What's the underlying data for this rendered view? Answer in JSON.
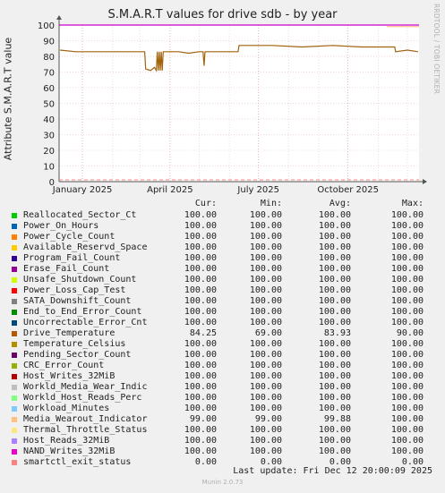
{
  "chart_data": {
    "type": "line",
    "title": "S.M.A.R.T values for drive sdb - by year",
    "ylabel": "Attribute S.M.A.R.T value",
    "xlabel": "",
    "ylim": [
      0,
      100
    ],
    "yticks": [
      0,
      10,
      20,
      30,
      40,
      50,
      60,
      70,
      80,
      90,
      100
    ],
    "xticks": [
      "January 2025",
      "April 2025",
      "July 2025",
      "October 2025"
    ],
    "grid": true,
    "side_note": "RRDTOOL / TOBI OETIKER",
    "series_flat_100_color": "#cc00cc",
    "drive_temperature": {
      "color": "#a0620a",
      "points": [
        [
          "2024-12-09",
          84
        ],
        [
          "2024-12-25",
          83
        ],
        [
          "2025-01-20",
          83
        ],
        [
          "2025-02-20",
          83
        ],
        [
          "2025-03-06",
          83
        ],
        [
          "2025-03-07",
          72
        ],
        [
          "2025-03-12",
          71
        ],
        [
          "2025-03-16",
          73
        ],
        [
          "2025-03-18",
          71
        ],
        [
          "2025-03-19",
          83
        ],
        [
          "2025-03-20",
          71
        ],
        [
          "2025-03-21",
          83
        ],
        [
          "2025-03-22",
          71
        ],
        [
          "2025-03-23",
          83
        ],
        [
          "2025-03-24",
          71
        ],
        [
          "2025-03-25",
          83
        ],
        [
          "2025-04-10",
          83
        ],
        [
          "2025-04-20",
          82
        ],
        [
          "2025-05-01",
          83
        ],
        [
          "2025-05-05",
          83
        ],
        [
          "2025-05-06",
          74
        ],
        [
          "2025-05-07",
          83
        ],
        [
          "2025-05-20",
          83
        ],
        [
          "2025-06-10",
          83
        ],
        [
          "2025-06-11",
          87
        ],
        [
          "2025-07-15",
          87
        ],
        [
          "2025-08-15",
          86
        ],
        [
          "2025-09-15",
          87
        ],
        [
          "2025-10-15",
          86
        ],
        [
          "2025-11-18",
          86
        ],
        [
          "2025-11-19",
          83
        ],
        [
          "2025-12-01",
          84
        ],
        [
          "2025-12-12",
          83
        ]
      ]
    },
    "media_wearout_indicator": {
      "color": "#ffb380",
      "value_from": 99
    }
  },
  "legend_headers": {
    "cur": "Cur:",
    "min": "Min:",
    "avg": "Avg:",
    "max": "Max:"
  },
  "legend": [
    {
      "name": "Reallocated_Sector_Ct",
      "color": "#00cc00",
      "cur": "100.00",
      "min": "100.00",
      "avg": "100.00",
      "max": "100.00"
    },
    {
      "name": "Power_On_Hours",
      "color": "#0066b3",
      "cur": "100.00",
      "min": "100.00",
      "avg": "100.00",
      "max": "100.00"
    },
    {
      "name": "Power_Cycle_Count",
      "color": "#ff8000",
      "cur": "100.00",
      "min": "100.00",
      "avg": "100.00",
      "max": "100.00"
    },
    {
      "name": "Available_Reservd_Space",
      "color": "#ffcc00",
      "cur": "100.00",
      "min": "100.00",
      "avg": "100.00",
      "max": "100.00"
    },
    {
      "name": "Program_Fail_Count",
      "color": "#330099",
      "cur": "100.00",
      "min": "100.00",
      "avg": "100.00",
      "max": "100.00"
    },
    {
      "name": "Erase_Fail_Count",
      "color": "#990099",
      "cur": "100.00",
      "min": "100.00",
      "avg": "100.00",
      "max": "100.00"
    },
    {
      "name": "Unsafe_Shutdown_Count",
      "color": "#ccff00",
      "cur": "100.00",
      "min": "100.00",
      "avg": "100.00",
      "max": "100.00"
    },
    {
      "name": "Power_Loss_Cap_Test",
      "color": "#ff0000",
      "cur": "100.00",
      "min": "100.00",
      "avg": "100.00",
      "max": "100.00"
    },
    {
      "name": "SATA_Downshift_Count",
      "color": "#808080",
      "cur": "100.00",
      "min": "100.00",
      "avg": "100.00",
      "max": "100.00"
    },
    {
      "name": "End_to_End_Error_Count",
      "color": "#008f00",
      "cur": "100.00",
      "min": "100.00",
      "avg": "100.00",
      "max": "100.00"
    },
    {
      "name": "Uncorrectable_Error_Cnt",
      "color": "#00487d",
      "cur": "100.00",
      "min": "100.00",
      "avg": "100.00",
      "max": "100.00"
    },
    {
      "name": "Drive_Temperature",
      "color": "#b35a00",
      "cur": "84.25",
      "min": "69.00",
      "avg": "83.93",
      "max": "90.00"
    },
    {
      "name": "Temperature_Celsius",
      "color": "#b38f00",
      "cur": "100.00",
      "min": "100.00",
      "avg": "100.00",
      "max": "100.00"
    },
    {
      "name": "Pending_Sector_Count",
      "color": "#6b006b",
      "cur": "100.00",
      "min": "100.00",
      "avg": "100.00",
      "max": "100.00"
    },
    {
      "name": "CRC_Error_Count",
      "color": "#8fb300",
      "cur": "100.00",
      "min": "100.00",
      "avg": "100.00",
      "max": "100.00"
    },
    {
      "name": "Host_Writes_32MiB",
      "color": "#b30000",
      "cur": "100.00",
      "min": "100.00",
      "avg": "100.00",
      "max": "100.00"
    },
    {
      "name": "Workld_Media_Wear_Indic",
      "color": "#bebebe",
      "cur": "100.00",
      "min": "100.00",
      "avg": "100.00",
      "max": "100.00"
    },
    {
      "name": "Workld_Host_Reads_Perc",
      "color": "#80ff80",
      "cur": "100.00",
      "min": "100.00",
      "avg": "100.00",
      "max": "100.00"
    },
    {
      "name": "Workload_Minutes",
      "color": "#80c9ff",
      "cur": "100.00",
      "min": "100.00",
      "avg": "100.00",
      "max": "100.00"
    },
    {
      "name": "Media_Wearout_Indicator",
      "color": "#ffc080",
      "cur": "99.00",
      "min": "99.00",
      "avg": "99.88",
      "max": "100.00"
    },
    {
      "name": "Thermal_Throttle_Status",
      "color": "#ffe680",
      "cur": "100.00",
      "min": "100.00",
      "avg": "100.00",
      "max": "100.00"
    },
    {
      "name": "Host_Reads_32MiB",
      "color": "#aa80ff",
      "cur": "100.00",
      "min": "100.00",
      "avg": "100.00",
      "max": "100.00"
    },
    {
      "name": "NAND_Writes_32MiB",
      "color": "#ee00cc",
      "cur": "100.00",
      "min": "100.00",
      "avg": "100.00",
      "max": "100.00"
    },
    {
      "name": "smartctl_exit_status",
      "color": "#ff8080",
      "cur": "0.00",
      "min": "0.00",
      "avg": "0.00",
      "max": "0.00"
    }
  ],
  "last_update": "Last update: Fri Dec 12 20:00:09 2025",
  "footer": "Munin 2.0.73"
}
